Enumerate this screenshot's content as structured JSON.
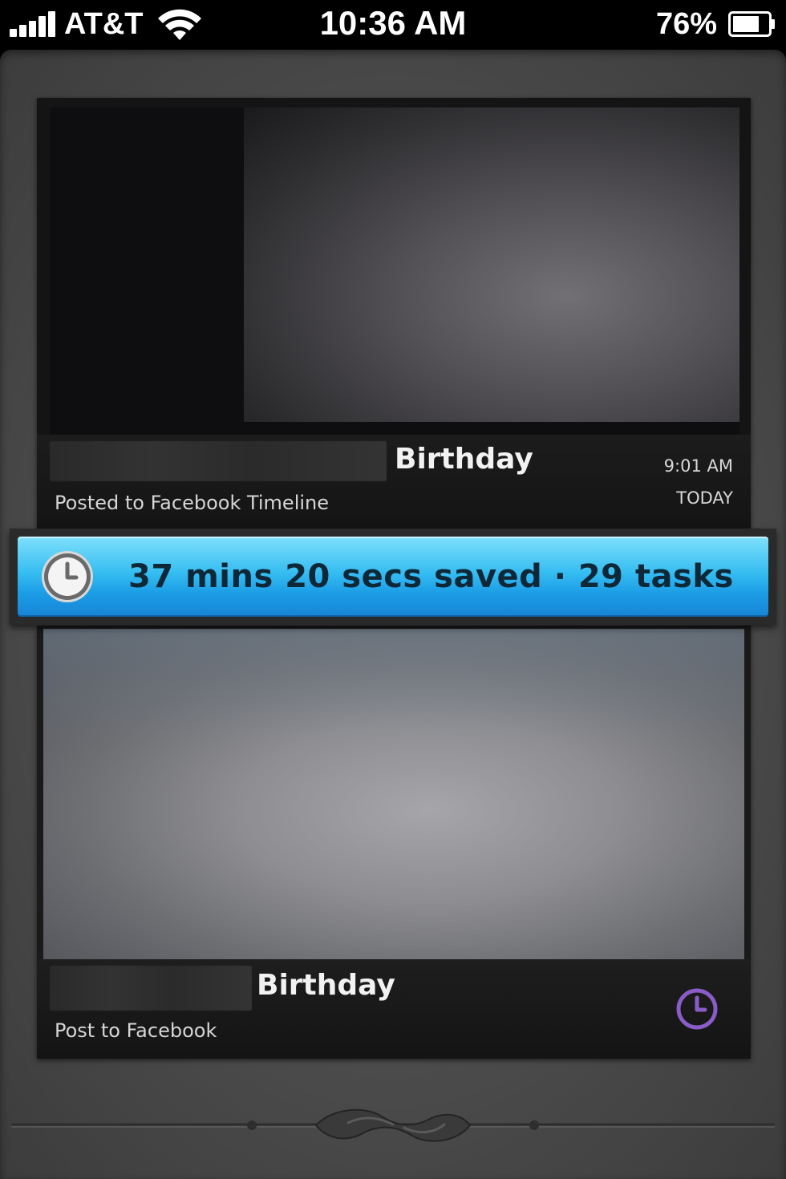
{
  "status_bar": {
    "carrier": "AT&T",
    "time": "10:36 AM",
    "battery_percent": "76%",
    "signal_bars": 5,
    "battery_level": 0.76
  },
  "cards": [
    {
      "title": "Birthday",
      "subtitle": "Posted to Facebook Timeline",
      "time": "9:01 AM",
      "day": "TODAY"
    },
    {
      "title": "Birthday",
      "subtitle": "Post to Facebook",
      "status_icon": "clock-icon"
    }
  ],
  "banner": {
    "text": "37 mins 20 secs saved · 29 tasks",
    "icon": "clock-icon"
  },
  "colors": {
    "banner_blue": "#36bdf1",
    "scheduled_purple": "#8a5cc8"
  }
}
